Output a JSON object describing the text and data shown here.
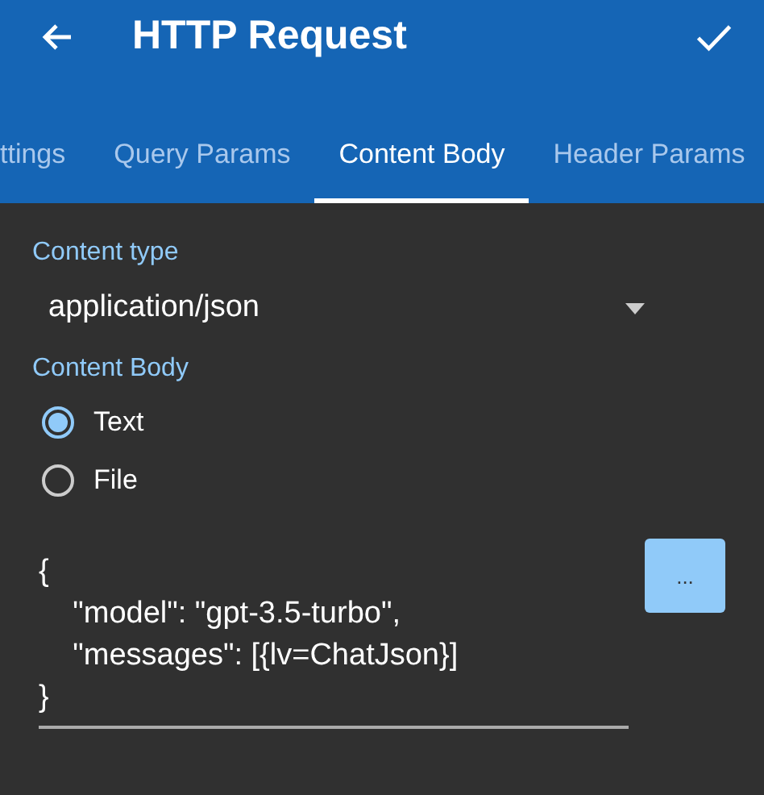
{
  "app_bar": {
    "title": "HTTP Request"
  },
  "tabs": [
    {
      "label": "ttings",
      "selected": false
    },
    {
      "label": "Query Params",
      "selected": false
    },
    {
      "label": "Content Body",
      "selected": true
    },
    {
      "label": "Header Params",
      "selected": false
    }
  ],
  "content_type": {
    "label": "Content type",
    "value": "application/json"
  },
  "content_body": {
    "label": "Content Body",
    "options": [
      {
        "label": "Text",
        "selected": true
      },
      {
        "label": "File",
        "selected": false
      }
    ],
    "value": "{\n    \"model\": \"gpt-3.5-turbo\",\n    \"messages\": [{lv=ChatJson}]\n}",
    "button": "..."
  }
}
